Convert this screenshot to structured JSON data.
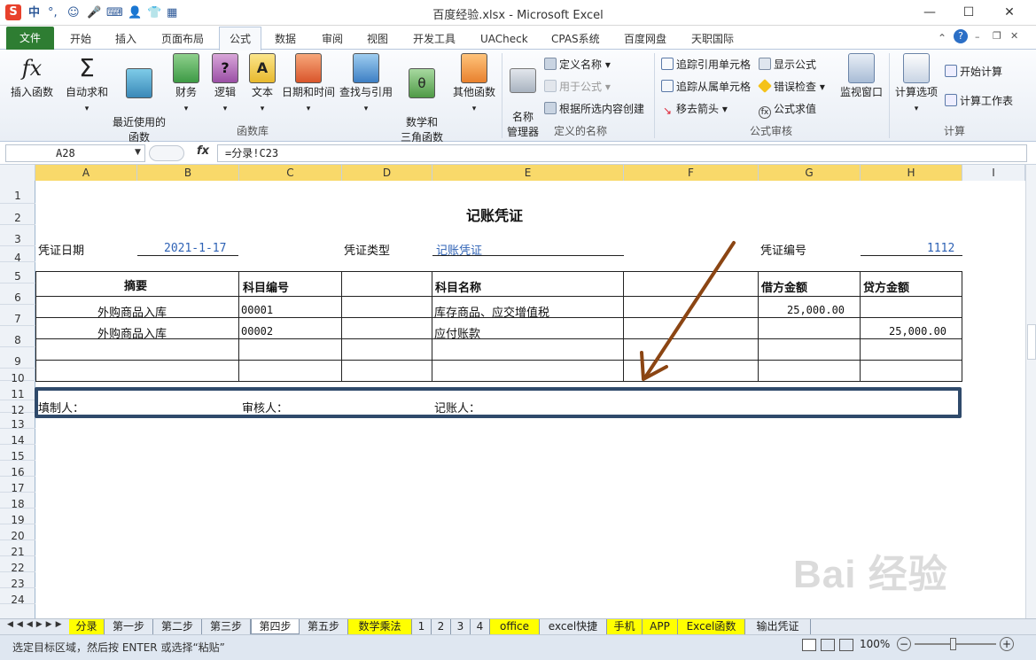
{
  "window": {
    "title": "百度经验.xlsx - Microsoft Excel",
    "controls": [
      "—",
      "☐",
      "✕"
    ]
  },
  "quick_access": {
    "items": [
      "S",
      "中",
      "°,",
      "☺",
      "🎤",
      "⌨",
      "👤",
      "👕",
      "▦"
    ]
  },
  "tabs": [
    "文件",
    "开始",
    "插入",
    "页面布局",
    "公式",
    "数据",
    "审阅",
    "视图",
    "开发工具",
    "UACheck",
    "CPAS系统",
    "百度网盘",
    "天职国际"
  ],
  "ribbon": {
    "function_library": {
      "label": "函数库",
      "buttons": [
        "插入函数",
        "自动求和",
        "最近使用的\n函数",
        "财务",
        "逻辑",
        "文本",
        "日期和时间",
        "查找与引用",
        "数学和\n三角函数",
        "其他函数"
      ]
    },
    "defined_names": {
      "label": "定义的名称",
      "big": "名称\n管理器",
      "items": [
        "定义名称",
        "用于公式",
        "根据所选内容创建"
      ]
    },
    "formula_auditing": {
      "label": "公式审核",
      "items": [
        "追踪引用单元格",
        "追踪从属单元格",
        "移去箭头",
        "显示公式",
        "错误检查",
        "公式求值"
      ],
      "big": "监视窗口"
    },
    "calculation": {
      "label": "计算",
      "big": "计算选项",
      "items": [
        "开始计算",
        "计算工作表"
      ]
    }
  },
  "formula_bar": {
    "name_box": "A28",
    "fx": "fx",
    "formula": "=分录!C23"
  },
  "columns": [
    "A",
    "B",
    "C",
    "D",
    "E",
    "F",
    "G",
    "H",
    "I"
  ],
  "rows": [
    "1",
    "2",
    "3",
    "4",
    "5",
    "6",
    "7",
    "8",
    "9",
    "10",
    "11",
    "12",
    "13",
    "14",
    "15",
    "16",
    "17",
    "18",
    "19",
    "20",
    "21",
    "22",
    "23",
    "24"
  ],
  "voucher": {
    "title": "记账凭证",
    "date_label": "凭证日期",
    "date": "2021-1-17",
    "type_label": "凭证类型",
    "type": "记账凭证",
    "no_label": "凭证编号",
    "no": "1112",
    "headers": {
      "summary": "摘要",
      "account_code": "科目编号",
      "account_name": "科目名称",
      "debit": "借方金额",
      "credit": "贷方金额"
    },
    "lines": [
      {
        "summary": "外购商品入库",
        "code": "00001",
        "name": "库存商品、应交增值税",
        "debit": "25,000.00",
        "credit": ""
      },
      {
        "summary": "外购商品入库",
        "code": "00002",
        "name": "应付账款",
        "debit": "",
        "credit": "25,000.00"
      }
    ],
    "preparer": "填制人：",
    "reviewer": "审核人：",
    "bookkeeper": "记账人："
  },
  "sheet_tabs": [
    "分录",
    "第一步",
    "第二步",
    "第三步",
    "第四步",
    "第五步",
    "数学乘法",
    "1",
    "2",
    "3",
    "4",
    "office",
    "excel快捷",
    "手机",
    "APP",
    "Excel函数",
    "输出凭证"
  ],
  "active_sheet": "第四步",
  "status": {
    "message": "选定目标区域，然后按 ENTER 或选择“粘贴”",
    "zoom": "100%"
  },
  "watermark": "Bai 经验",
  "colors": {
    "file_tab": "#2e7d32",
    "accent_blue": "#2e62b5",
    "header_yellow": "#f9d96a",
    "arrow": "#8b4513",
    "box_border": "#2f4a6b"
  }
}
